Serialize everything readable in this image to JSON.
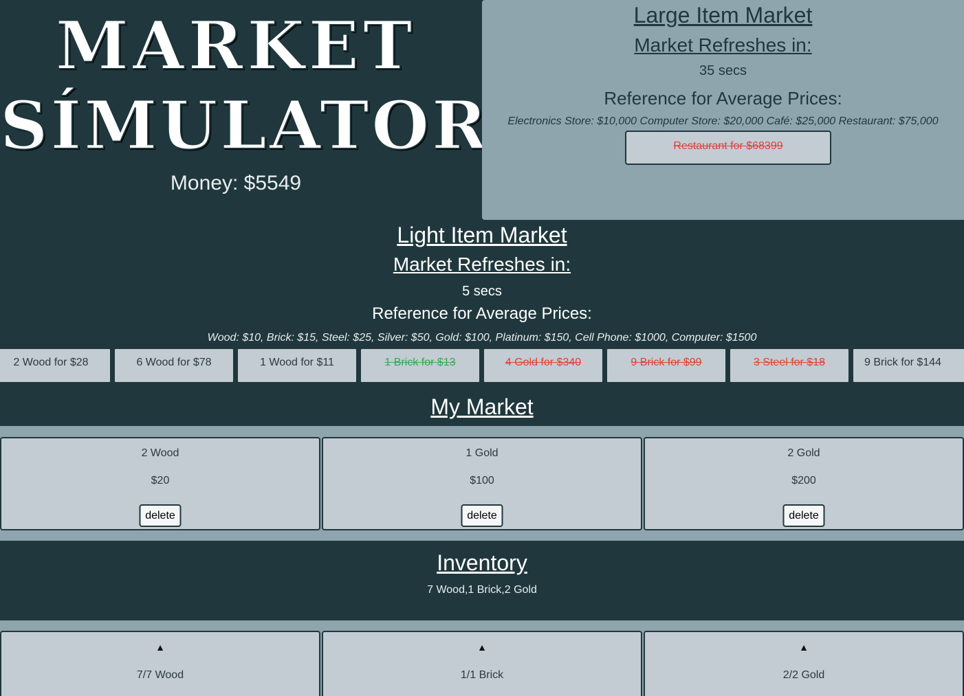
{
  "header": {
    "title_line1": "MARKET",
    "title_line2": "SÍMULATOR",
    "money": "Money: $5549"
  },
  "large_market": {
    "title": "Large Item Market",
    "refresh_label": "Market Refreshes in:",
    "refresh_time": "35 secs",
    "reference_label": "Reference for Average Prices:",
    "reference_prices": "Electronics Store: $10,000 Computer Store: $20,000 Café: $25,000 Restaurant: $75,000",
    "offers": [
      {
        "label": "Restaurant for $68399",
        "status": "unavailable",
        "color": "#e0413a"
      }
    ]
  },
  "light_market": {
    "title": "Light Item Market",
    "refresh_label": "Market Refreshes in:",
    "refresh_time": "5 secs",
    "reference_label": "Reference for Average Prices:",
    "reference_prices": "Wood: $10, Brick: $15, Steel: $25, Silver: $50, Gold: $100, Platinum: $150, Cell Phone: $1000, Computer: $1500",
    "offers": [
      {
        "label": "2 Wood for $28",
        "status": "available"
      },
      {
        "label": "6 Wood for $78",
        "status": "available"
      },
      {
        "label": "1 Wood for $11",
        "status": "available"
      },
      {
        "label": "1 Brick for $13",
        "status": "bought",
        "color": "#3aa655"
      },
      {
        "label": "4 Gold for $340",
        "status": "unavailable",
        "color": "#e0413a"
      },
      {
        "label": "9 Brick for $99",
        "status": "unavailable",
        "color": "#e0413a"
      },
      {
        "label": "3 Steel for $18",
        "status": "unavailable",
        "color": "#e0413a"
      },
      {
        "label": "9 Brick for $144",
        "status": "available"
      }
    ]
  },
  "my_market": {
    "title": "My Market",
    "listings": [
      {
        "item": "2 Wood",
        "price": "$20",
        "delete_label": "delete"
      },
      {
        "item": "1 Gold",
        "price": "$100",
        "delete_label": "delete"
      },
      {
        "item": "2 Gold",
        "price": "$200",
        "delete_label": "delete"
      }
    ]
  },
  "inventory": {
    "title": "Inventory",
    "summary": "7 Wood,1 Brick,2 Gold",
    "items": [
      {
        "arrow": "▲",
        "icon": "up-arrow-icon",
        "label": "7/7 Wood"
      },
      {
        "arrow": "▲",
        "icon": "up-arrow-icon",
        "label": "1/1 Brick"
      },
      {
        "arrow": "▲",
        "icon": "up-arrow-icon",
        "label": "2/2 Gold"
      }
    ]
  },
  "colors": {
    "background": "#20383d",
    "panel": "#8ea5ae",
    "card": "#c3ccd2",
    "unavailable": "#e0413a",
    "bought": "#3aa655"
  }
}
